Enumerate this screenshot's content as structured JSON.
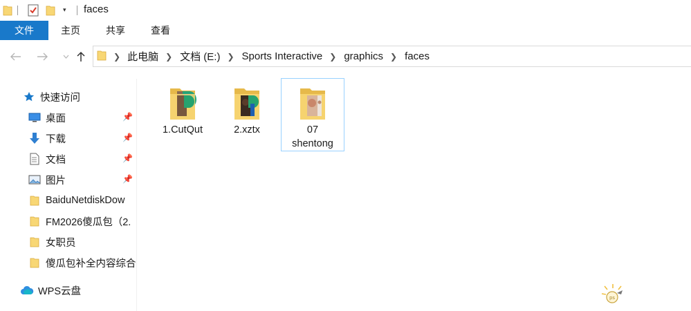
{
  "window": {
    "title": "faces"
  },
  "quick_access_toolbar": {
    "icons": [
      "folder-icon",
      "properties-check-icon",
      "new-folder-icon",
      "customize-dropdown-icon"
    ]
  },
  "ribbon": {
    "tabs": [
      {
        "label": "文件"
      },
      {
        "label": "主页"
      },
      {
        "label": "共享"
      },
      {
        "label": "查看"
      }
    ]
  },
  "nav": {
    "back_icon": "arrow-left-icon",
    "forward_icon": "arrow-right-icon",
    "up_icon": "arrow-up-icon"
  },
  "address_bar": {
    "breadcrumbs": [
      {
        "label": "此电脑"
      },
      {
        "label": "文档 (E:)"
      },
      {
        "label": "Sports Interactive"
      },
      {
        "label": "graphics"
      },
      {
        "label": "faces"
      }
    ]
  },
  "sidebar": {
    "quick_access_label": "快速访问",
    "items": [
      {
        "label": "桌面",
        "icon": "desktop-icon",
        "pinned": true
      },
      {
        "label": "下载",
        "icon": "download-icon",
        "pinned": true
      },
      {
        "label": "文档",
        "icon": "document-icon",
        "pinned": true
      },
      {
        "label": "图片",
        "icon": "pictures-icon",
        "pinned": true
      },
      {
        "label": "BaiduNetdiskDow",
        "icon": "folder-icon",
        "pinned": false
      },
      {
        "label": "FM2026傻瓜包（2.",
        "icon": "folder-icon",
        "pinned": false
      },
      {
        "label": "女职员",
        "icon": "folder-icon",
        "pinned": false
      },
      {
        "label": "傻瓜包补全内容综合",
        "icon": "folder-icon",
        "pinned": false
      }
    ],
    "wps_label": "WPS云盘"
  },
  "folders": [
    {
      "name": "1.CutQut"
    },
    {
      "name": "2.xztx"
    },
    {
      "name": "07\nshentong",
      "line1": "07",
      "line2": "shentong"
    }
  ],
  "colors": {
    "accent": "#1979ca",
    "folder_yellow": "#f8d775",
    "folder_dark": "#e6b94a",
    "selection_border": "#99d1ff"
  }
}
